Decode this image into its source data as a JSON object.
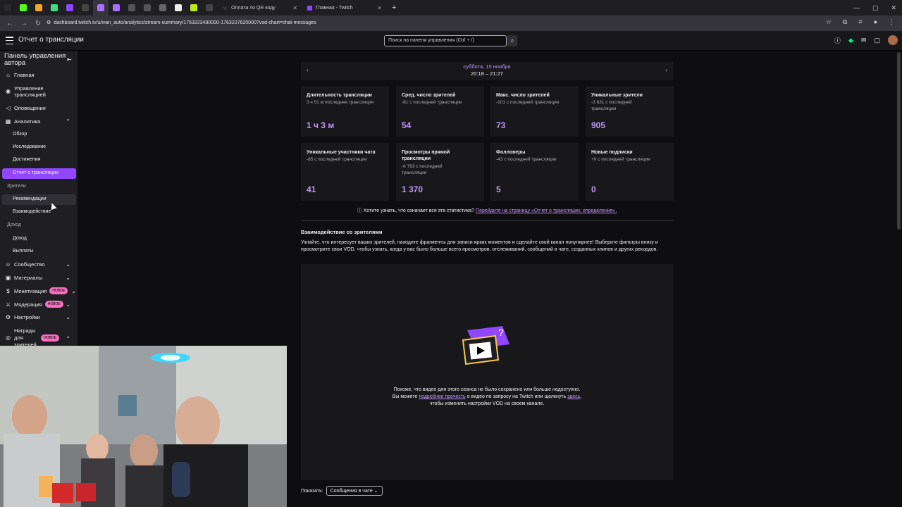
{
  "browser": {
    "tabs": [
      {
        "label": "Оплата по QR коду"
      },
      {
        "label": "Главная - Twitch"
      }
    ],
    "url": "dashboard.twitch.tv/u/ivan_auto/analytics/stream-summary/1763223480000-1763227620000?vod-chart=chat-messages"
  },
  "topnav": {
    "title": "Отчет о трансляции",
    "search_placeholder": "Поиск на панели управления (Ctrl + /)"
  },
  "sidebar": {
    "header": "Панель управления автора",
    "items": {
      "home": "Главная",
      "stream_manager": "Управление трансляцией",
      "alerts": "Оповещения",
      "analytics": "Аналитика",
      "overview": "Обзор",
      "research": "Исследование",
      "achievements": "Достижения",
      "stream_summary": "Отчет о трансляции",
      "viewers_group": "Зрители",
      "recommendations": "Рекомендации",
      "engagement": "Взаимодействие",
      "revenue_group": "Доход",
      "revenue": "Доход",
      "payouts": "Выплаты",
      "community": "Сообщество",
      "content": "Материалы",
      "monetization": "Монетизация",
      "moderation": "Модерация",
      "settings": "Настройки",
      "viewer_rewards": "Награды для зрителей"
    },
    "new_badge": "НОВОЕ"
  },
  "datebar": {
    "date": "суббота, 15 ноября",
    "time": "20:18 – 21:27"
  },
  "stats": [
    {
      "label": "Длительность трансляции",
      "sub": "3 ч 51 м последняя трансляция",
      "value": "1 ч 3 м"
    },
    {
      "label": "Сред. число зрителей",
      "sub": "-81 с последней трансляции",
      "value": "54"
    },
    {
      "label": "Макс. число зрителей",
      "sub": "-101 с последней трансляции",
      "value": "73"
    },
    {
      "label": "Уникальные зрители",
      "sub": "-3 831 с последней трансляции",
      "value": "905"
    },
    {
      "label": "Уникальные участники чата",
      "sub": "-85 с последней трансляции",
      "value": "41"
    },
    {
      "label": "Просмотры прямой трансляции",
      "sub": "-6 763 с последней трансляции",
      "value": "1 370"
    },
    {
      "label": "Фолловеры",
      "sub": "-43 с последней трансляции",
      "value": "5"
    },
    {
      "label": "Новые подписки",
      "sub": "+0 с последней трансляции",
      "value": "0"
    }
  ],
  "help": {
    "question": "Хотите узнать, что означает вся эта статистика?",
    "link": "Перейдите на страницу «Отчет о трансляции: определения»."
  },
  "engagement": {
    "title": "Взаимодействие со зрителями",
    "desc": "Узнайте, что интересует ваших зрителей, находите фрагменты для записи ярких моментов и сделайте свой канал популярнее! Выберите фильтры внизу и просмотрите свои VOD, чтобы узнать, когда у вас было больше всего просмотров, отслеживаний, сообщений в чате, созданных клипов и других рекордов."
  },
  "vod": {
    "line1": "Похоже, что видео для этого сеанса не было сохранено или больше недоступно.",
    "line2_pre": "Вы можете",
    "line2_link1": "подробнее прочесть",
    "line2_mid": "о видео по запросу на Twitch или щелкнуть",
    "line2_link2": "здесь",
    "line3": "чтобы изменить настройки VOD на своем канале."
  },
  "show": {
    "label": "Показать:",
    "selected": "Сообщения в чате"
  },
  "colors": {
    "accent": "#9147ff",
    "accent_text": "#bf94ff",
    "background": "#0e0e10",
    "panel": "#18181b"
  }
}
